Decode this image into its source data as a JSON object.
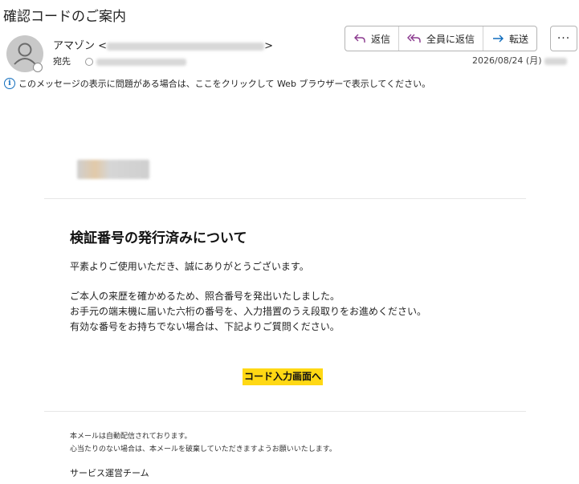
{
  "email": {
    "subject": "確認コードのご案内",
    "sender_name": "アマゾン",
    "sender_open": "<",
    "sender_close": ">",
    "to_label": "宛先",
    "date": "2026/08/24 (月)"
  },
  "actions": {
    "reply": "返信",
    "reply_all": "全員に返信",
    "forward": "転送",
    "more": "···"
  },
  "info_bar": {
    "icon": "info-icon",
    "text": "このメッセージの表示に問題がある場合は、ここをクリックして Web ブラウザーで表示してください。"
  },
  "body": {
    "heading": "検証番号の発行済みについて",
    "greeting": "平素よりご使用いただき、誠にありがとうございます。",
    "line1": "ご本人の来歴を確かめるため、照合番号を発出いたしました。",
    "line2": "お手元の端末機に届いた六桁の番号を、入力措置のうえ段取りをお進めください。",
    "line3": "有効な番号をお持ちでない場合は、下記よりご質問ください。",
    "cta": "コード入力画面へ",
    "footer1": "本メールは自動配信されております。",
    "footer2": "心当たりのない場合は、本メールを破棄していただきますようお願いいたします。",
    "team": "サービス運営チーム"
  },
  "colors": {
    "cta_background": "#ffd814",
    "accent_purple": "#8b3a8f",
    "accent_blue": "#0f6cbd"
  }
}
